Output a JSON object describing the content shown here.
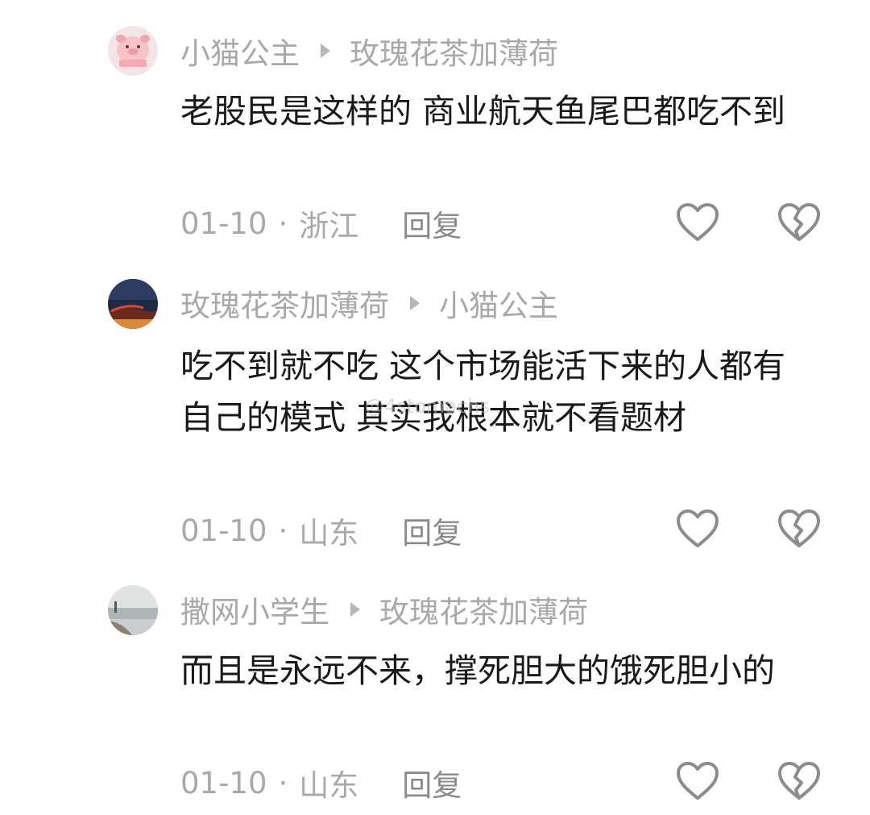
{
  "comments": [
    {
      "author": "小猫公主",
      "reply_to": "玫瑰花茶加薄荷",
      "text": "老股民是这样的 商业航天鱼尾巴都吃不到",
      "date": "01-10",
      "location": "浙江",
      "reply_label": "回复",
      "avatar": "pig-cartoon-avatar"
    },
    {
      "author": "玫瑰花茶加薄荷",
      "reply_to": "小猫公主",
      "text": "吃不到就不吃 这个市场能活下来的人都有自己的模式 其实我根本就不看题材",
      "date": "01-10",
      "location": "山东",
      "reply_label": "回复",
      "avatar": "sunset-horizon-avatar"
    },
    {
      "author": "撒网小学生",
      "reply_to": "玫瑰花茶加薄荷",
      "text": "而且是永远不来，撑死胆大的饿死胆小的",
      "date": "01-10",
      "location": "山东",
      "reply_label": "回复",
      "avatar": "lake-shore-avatar"
    }
  ],
  "separator": "·",
  "watermark": "@4stomachs",
  "colors": {
    "background": "#ffffff",
    "text": "#1a1a1a",
    "secondary": "#a9a9a9",
    "icon": "#8c8c8c"
  }
}
